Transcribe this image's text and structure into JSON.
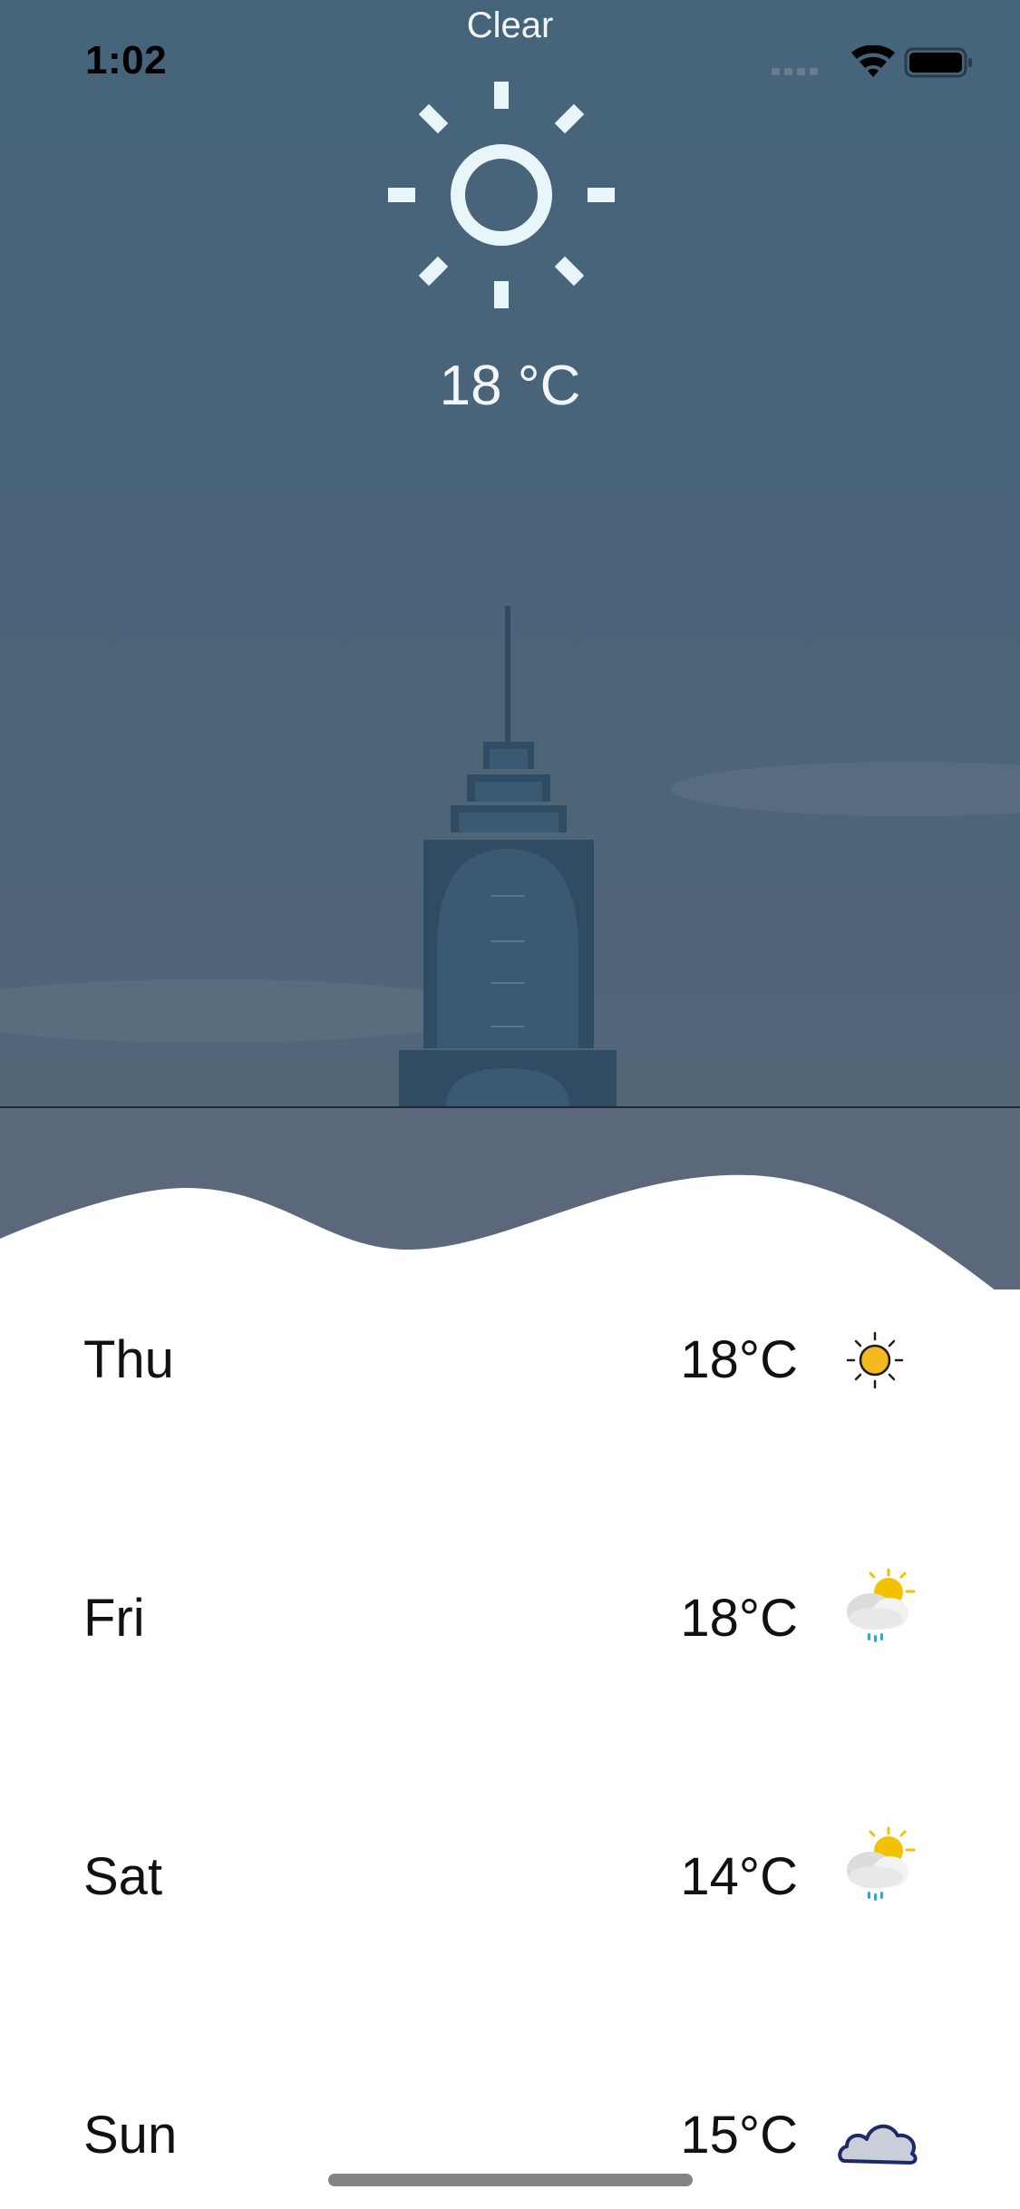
{
  "status_bar": {
    "time": "1:02"
  },
  "current": {
    "condition": "Clear",
    "temperature": "18 °C",
    "icon": "sun-icon"
  },
  "forecast": [
    {
      "day": "Thu",
      "temperature": "18°C",
      "icon": "sunny-icon"
    },
    {
      "day": "Fri",
      "temperature": "18°C",
      "icon": "partly-cloudy-rain-icon"
    },
    {
      "day": "Sat",
      "temperature": "14°C",
      "icon": "partly-cloudy-rain-icon"
    },
    {
      "day": "Sun",
      "temperature": "15°C",
      "icon": "cloud-icon"
    }
  ],
  "colors": {
    "sky": "#45647a",
    "ground": "#5b677b",
    "building": "#2f4c63",
    "sun_yellow": "#f5b81f"
  }
}
